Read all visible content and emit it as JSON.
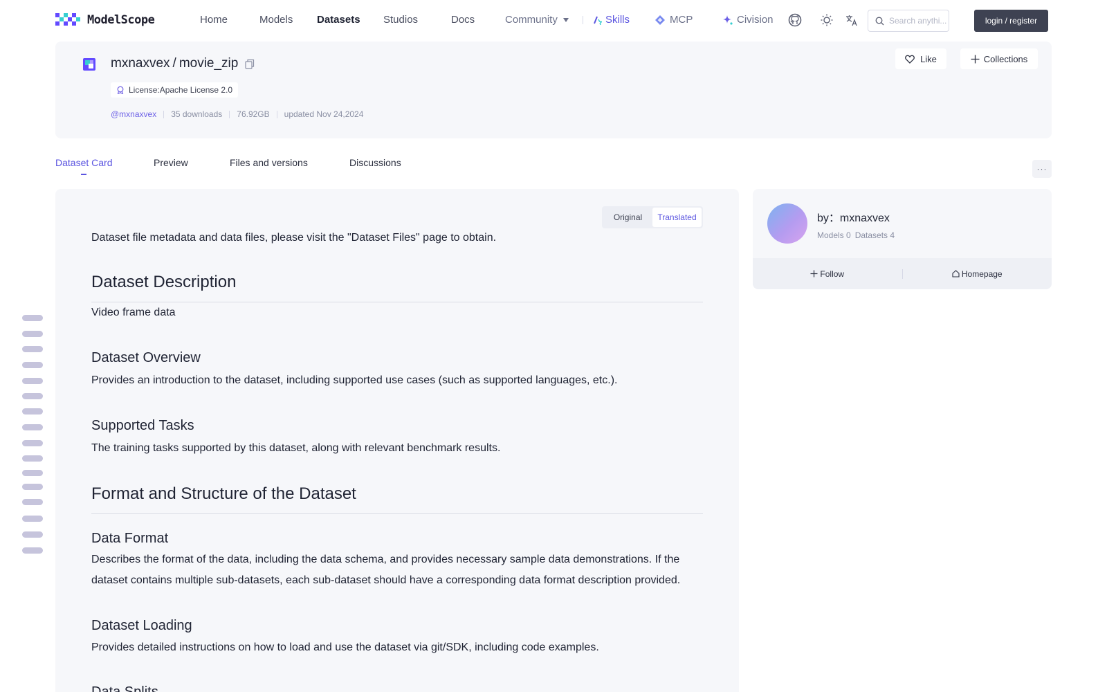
{
  "brand": {
    "name": "ModelScope"
  },
  "nav": {
    "home": "Home",
    "models": "Models",
    "datasets": "Datasets",
    "studios": "Studios",
    "docs": "Docs",
    "community": "Community",
    "skills": "Skills",
    "mcp": "MCP",
    "civision": "Civision"
  },
  "search": {
    "placeholder": "Search anythi..."
  },
  "auth": {
    "login_label": "login / register"
  },
  "dataset": {
    "owner": "mxnaxvex",
    "separator": "/",
    "name": "movie_zip",
    "license": "License:Apache License 2.0",
    "owner_handle": "@mxnaxvex",
    "downloads": "35 downloads",
    "size": "76.92GB",
    "updated": "updated Nov 24,2024"
  },
  "header_actions": {
    "like": "Like",
    "collections": "Collections"
  },
  "tabs": [
    "Dataset Card",
    "Preview",
    "Files and versions",
    "Discussions"
  ],
  "more_label": "···",
  "toggle": {
    "original": "Original",
    "translated": "Translated"
  },
  "card": {
    "intro": "Dataset file metadata and data files, please visit the \"Dataset Files\" page to obtain.",
    "h_description": "Dataset Description",
    "p_description": "Video frame data",
    "h_overview": "Dataset Overview",
    "p_overview": "Provides an introduction to the dataset, including supported use cases (such as supported languages, etc.).",
    "h_tasks": "Supported Tasks",
    "p_tasks": "The training tasks supported by this dataset, along with relevant benchmark results.",
    "h_format_structure": "Format and Structure of the Dataset",
    "h_data_format": "Data Format",
    "p_data_format_1": "Describes the format of the data, including the data schema, and provides necessary sample data demonstrations. If the",
    "p_data_format_2": "dataset contains multiple sub-datasets, each sub-dataset should have a corresponding data format description provided.",
    "h_loading": "Dataset Loading",
    "p_loading": "Provides detailed instructions on how to load and use the dataset via git/SDK, including code examples.",
    "h_splits": "Data Splits"
  },
  "author": {
    "by": "by：mxnaxvex",
    "models": "Models 0",
    "datasets": "Datasets 4",
    "follow": "Follow",
    "homepage": "Homepage"
  },
  "colors": {
    "accent": "#5b55e0",
    "panel": "#f6f7fa",
    "login_bg": "#3e4252"
  },
  "icons": [
    "github-icon",
    "sun-icon",
    "translate-icon",
    "search-icon",
    "heart-icon",
    "plus-icon",
    "copy-icon",
    "badge-icon",
    "home-icon",
    "sparkle-icon"
  ]
}
